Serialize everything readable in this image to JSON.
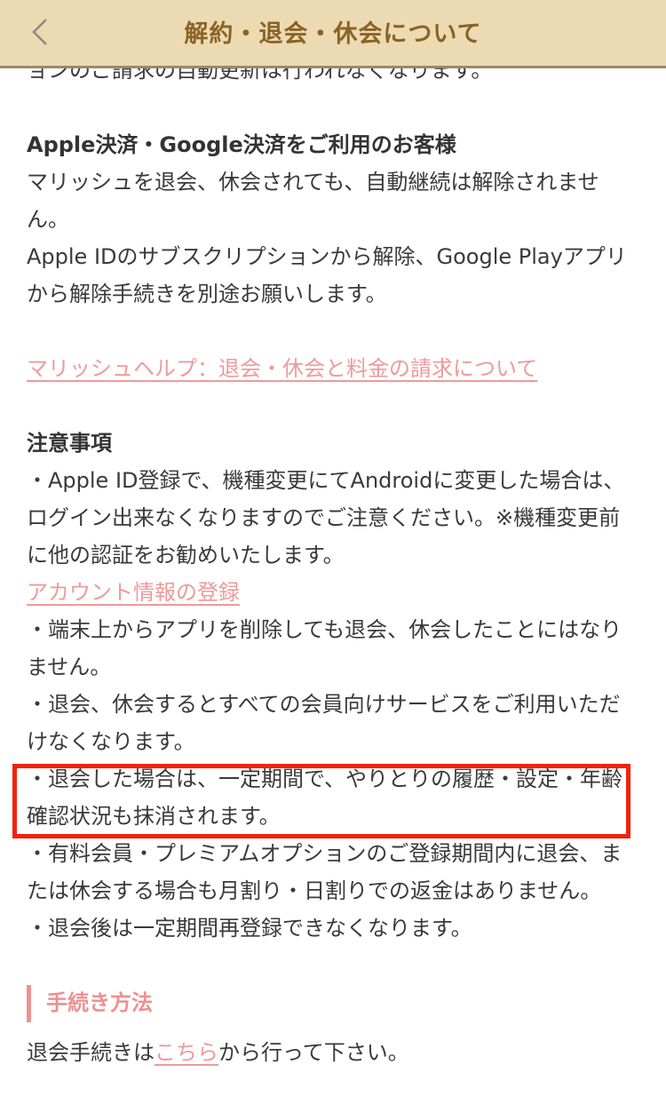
{
  "header": {
    "title": "解約・退会・休会について",
    "back_icon": "chevron-left-icon"
  },
  "content": {
    "clipped_line": "ョンのご請求の自動更新は行われなくなります。",
    "apple_google": {
      "heading": "Apple決済・Google決済をご利用のお客様",
      "lines": [
        "マリッシュを退会、休会されても、自動継続は解除されません。",
        "Apple IDのサブスクリプションから解除、Google Playアプリから解除手続きを別途お願いします。"
      ]
    },
    "help_link": "マリッシュヘルプ：退会・休会と料金の請求について",
    "notes": {
      "heading": "注意事項",
      "item1": "・Apple ID登録で、機種変更にてAndroidに変更した場合は、ログイン出来なくなりますのでご注意ください。※機種変更前に他の認証をお勧めいたします。",
      "account_link": "アカウント情報の登録",
      "item2": "・端末上からアプリを削除しても退会、休会したことにはなりません。",
      "item3": "・退会、休会するとすべての会員向けサービスをご利用いただけなくなります。",
      "item4_highlighted": "・退会した場合は、一定期間で、やりとりの履歴・設定・年齢確認状況も抹消されます。",
      "item5": "・有料会員・プレミアムオプションのご登録期間内に退会、または休会する場合も月割り・日割りでの返金はありません。",
      "item6": "・退会後は一定期間再登録できなくなります。"
    },
    "procedure": {
      "heading": "手続き方法",
      "text_before": "退会手続きは",
      "link": "こちら",
      "text_after": "から行って下さい。"
    }
  },
  "colors": {
    "header_bg": "#ecdab3",
    "header_title": "#8a6424",
    "link": "#ee9a9a",
    "section_accent": "#ee9090",
    "highlight_border": "#f2220e"
  }
}
